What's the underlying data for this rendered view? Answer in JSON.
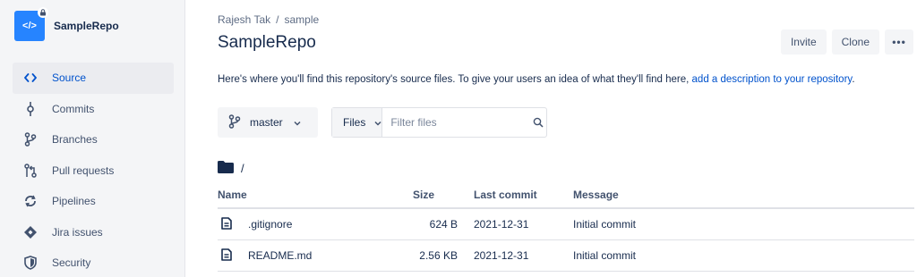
{
  "repo": {
    "name": "SampleRepo",
    "avatar_glyph": "</>",
    "accent_color": "#2684ff"
  },
  "sidebar": {
    "items": [
      {
        "label": "Source",
        "icon": "code-icon",
        "active": true
      },
      {
        "label": "Commits",
        "icon": "commit-icon",
        "active": false
      },
      {
        "label": "Branches",
        "icon": "branch-icon",
        "active": false
      },
      {
        "label": "Pull requests",
        "icon": "pull-request-icon",
        "active": false
      },
      {
        "label": "Pipelines",
        "icon": "pipelines-icon",
        "active": false
      },
      {
        "label": "Jira issues",
        "icon": "jira-icon",
        "active": false
      },
      {
        "label": "Security",
        "icon": "shield-icon",
        "active": false
      }
    ]
  },
  "breadcrumb": {
    "workspace": "Rajesh Tak",
    "separator": "/",
    "project": "sample"
  },
  "header": {
    "title": "SampleRepo",
    "invite_label": "Invite",
    "clone_label": "Clone",
    "more_label": "•••"
  },
  "description": {
    "text": "Here's where you'll find this repository's source files. To give your users an idea of what they'll find here,",
    "link": "add a description to your repository",
    "end": "."
  },
  "controls": {
    "branch": "master",
    "files_dropdown": "Files",
    "filter_placeholder": "Filter files"
  },
  "path": {
    "current": "/"
  },
  "table": {
    "columns": {
      "name": "Name",
      "size": "Size",
      "last_commit": "Last commit",
      "message": "Message"
    },
    "rows": [
      {
        "name": ".gitignore",
        "size": "624 B",
        "last_commit": "2021-12-31",
        "message": "Initial commit"
      },
      {
        "name": "README.md",
        "size": "2.56 KB",
        "last_commit": "2021-12-31",
        "message": "Initial commit"
      }
    ]
  }
}
